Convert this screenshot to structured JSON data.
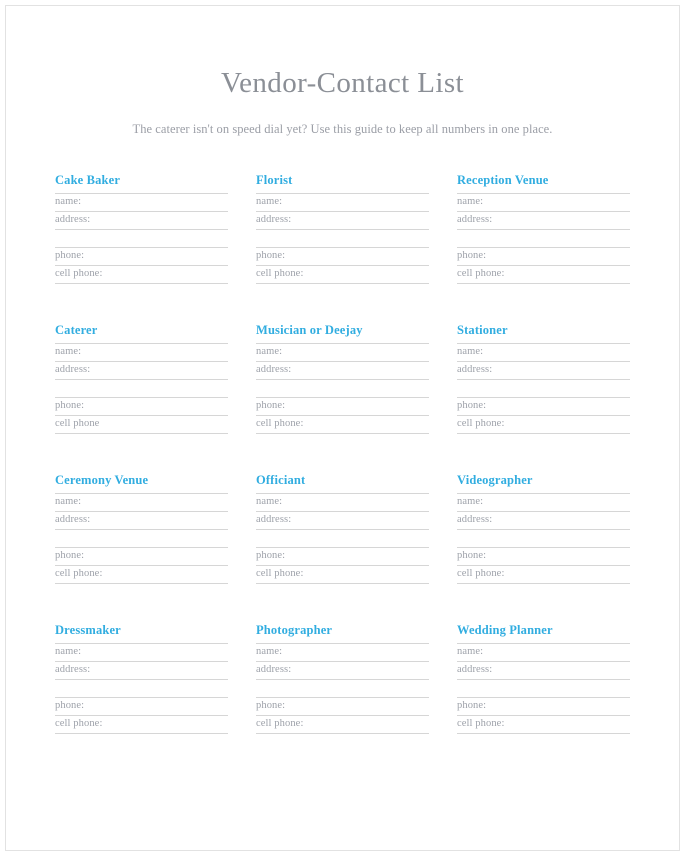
{
  "page": {
    "title": "Vendor-Contact List",
    "subtitle": "The caterer isn't on speed dial yet? Use this guide to keep all numbers in one place.",
    "colors": {
      "heading_cyan": "#31ade0",
      "title_gray": "#8b8f96",
      "subtitle_gray": "#9b9ea6",
      "label_gray": "#9ea2aa",
      "rule_gray": "#d6d6d6",
      "page_frame": "#e2e2e2",
      "background": "#ffffff"
    }
  },
  "vendors": [
    {
      "heading": "Cake Baker",
      "fields": [
        {
          "label": "name:"
        },
        {
          "label": "address:"
        },
        {
          "label": ""
        },
        {
          "label": "phone:"
        },
        {
          "label": "cell phone:"
        }
      ]
    },
    {
      "heading": "Florist",
      "fields": [
        {
          "label": "name:"
        },
        {
          "label": "address:"
        },
        {
          "label": ""
        },
        {
          "label": "phone:"
        },
        {
          "label": "cell phone:"
        }
      ]
    },
    {
      "heading": "Reception Venue",
      "fields": [
        {
          "label": "name:"
        },
        {
          "label": "address:"
        },
        {
          "label": ""
        },
        {
          "label": "phone:"
        },
        {
          "label": "cell phone:"
        }
      ]
    },
    {
      "heading": "Caterer",
      "fields": [
        {
          "label": "name:"
        },
        {
          "label": "address:"
        },
        {
          "label": ""
        },
        {
          "label": "phone:"
        },
        {
          "label": "cell phone"
        }
      ]
    },
    {
      "heading": "Musician or Deejay",
      "fields": [
        {
          "label": "name:"
        },
        {
          "label": "address:"
        },
        {
          "label": ""
        },
        {
          "label": "phone:"
        },
        {
          "label": "cell phone:"
        }
      ]
    },
    {
      "heading": "Stationer",
      "fields": [
        {
          "label": "name:"
        },
        {
          "label": "address:"
        },
        {
          "label": ""
        },
        {
          "label": "phone:"
        },
        {
          "label": "cell phone:"
        }
      ]
    },
    {
      "heading": "Ceremony Venue",
      "fields": [
        {
          "label": "name:"
        },
        {
          "label": "address:"
        },
        {
          "label": ""
        },
        {
          "label": "phone:"
        },
        {
          "label": "cell phone:"
        }
      ]
    },
    {
      "heading": "Officiant",
      "fields": [
        {
          "label": "name:"
        },
        {
          "label": "address:"
        },
        {
          "label": ""
        },
        {
          "label": "phone:"
        },
        {
          "label": "cell phone:"
        }
      ]
    },
    {
      "heading": "Videographer",
      "fields": [
        {
          "label": "name:"
        },
        {
          "label": "address:"
        },
        {
          "label": ""
        },
        {
          "label": "phone:"
        },
        {
          "label": "cell phone:"
        }
      ]
    },
    {
      "heading": "Dressmaker",
      "fields": [
        {
          "label": "name:"
        },
        {
          "label": "address:"
        },
        {
          "label": ""
        },
        {
          "label": "phone:"
        },
        {
          "label": "cell phone:"
        }
      ]
    },
    {
      "heading": "Photographer",
      "fields": [
        {
          "label": "name:"
        },
        {
          "label": "address:"
        },
        {
          "label": ""
        },
        {
          "label": "phone:"
        },
        {
          "label": "cell phone:"
        }
      ]
    },
    {
      "heading": "Wedding Planner",
      "fields": [
        {
          "label": "name:"
        },
        {
          "label": "address:"
        },
        {
          "label": ""
        },
        {
          "label": "phone:"
        },
        {
          "label": "cell phone:"
        }
      ]
    }
  ]
}
